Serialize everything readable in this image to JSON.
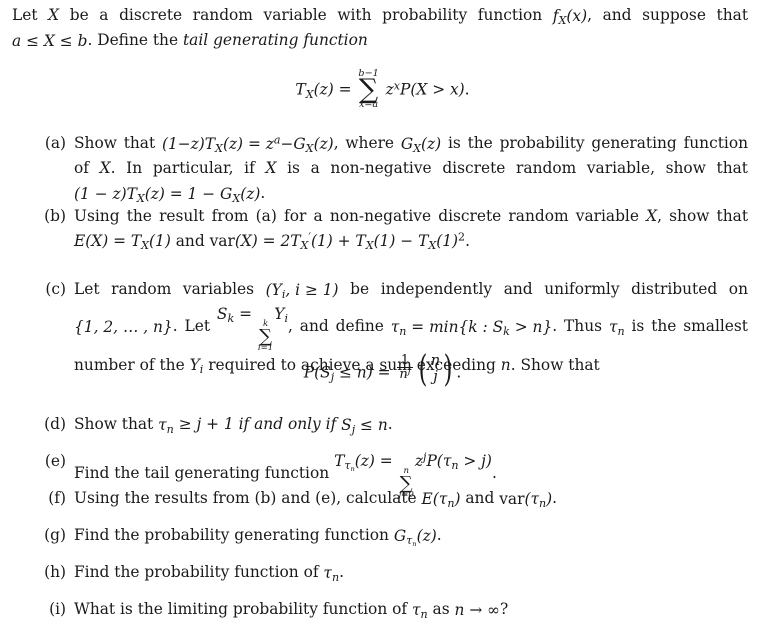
{
  "document": {
    "type": "mathematics-problem-set",
    "background_color": "#ffffff",
    "text_color": "#1a1a1a"
  },
  "intro": {
    "line1_a": "Let ",
    "var_X": "X",
    "line1_b": " be a discrete random variable with probability function ",
    "fx": {
      "base": "f",
      "sub": "X",
      "arg": "(x)"
    },
    "line1_c": ", and suppose that ",
    "cond_a": "a",
    "cond_le1": "≤",
    "cond_X": "X",
    "cond_le2": "≤",
    "cond_b": "b",
    "line2_a": ". Define the ",
    "emphasis": "tail generating function"
  },
  "main_equation": {
    "lhs_T": "T",
    "lhs_sub": "X",
    "lhs_arg": "(z)",
    "equals": "=",
    "sum_upper": "b−1",
    "sum_symbol": "∑",
    "sum_lower": "x=a",
    "term_z": "z",
    "term_exp": "x",
    "term_P": "P",
    "term_body": "(X > x)",
    "period": "."
  },
  "items": [
    {
      "label": "(a)",
      "text_parts": {
        "p1": "Show that ",
        "eq1": "(1−z)T",
        "eq1_sub": "X",
        "eq1_rest": "(z) = z",
        "eq1_exp": "a",
        "eq1_tail": "−G",
        "eq1_sub2": "X",
        "eq1_tail2": "(z)",
        "p2": ", where ",
        "eq2": "G",
        "eq2_sub": "X",
        "eq2_rest": "(z)",
        "p3": " is the probability generating function of ",
        "var2": "X",
        "p4": ". In particular, if ",
        "var3": "X",
        "p5": " is a non-negative discrete random variable, show that ",
        "eq3": "(1 − z)T",
        "eq3_sub": "X",
        "eq3_rest": "(z) = 1 − G",
        "eq3_sub2": "X",
        "eq3_tail": "(z)",
        "p6": "."
      }
    },
    {
      "label": "(b)",
      "text_parts": {
        "p1": "Using the result from (a) for a non-negative discrete random variable ",
        "var1": "X",
        "p2": ", show that ",
        "eq_E": "E(X) = T",
        "eq_E_sub": "X",
        "eq_E_rest": "(1)",
        "p3": " and ",
        "var_label": "var",
        "eq_v1": "(X) = 2T",
        "eq_v1_sub": "X",
        "eq_v1_prime": "′",
        "eq_v1_rest": "(1) + T",
        "eq_v2_sub": "X",
        "eq_v2_rest": "(1) − T",
        "eq_v3_sub": "X",
        "eq_v3_rest": "(1)",
        "eq_v3_exp": "2",
        "p4": "."
      }
    },
    {
      "label": "(c)",
      "text_parts": {
        "p1": "Let random variables ",
        "rv": "(Y",
        "rv_sub": "i",
        "rv_rest": ", i ≥ 1)",
        "p2": " be independently and uniformly distributed on ",
        "set": "{1, 2, … , n}",
        "p3": ". Let ",
        "S": "S",
        "S_sub": "k",
        "S_eq": " = ",
        "sum_upper": "k",
        "sum_lower": "i=1",
        "sum_body": "Y",
        "sum_body_sub": "i",
        "p4": ", and define ",
        "tau": "τ",
        "tau_sub": "n",
        "tau_def": " = min{k : S",
        "tau_def_sub": "k",
        "tau_def_rest": " > n}",
        "p5": ". Thus ",
        "tau2": "τ",
        "tau2_sub": "n",
        "p6": " is the smallest number of the ",
        "Y2": "Y",
        "Y2_sub": "i",
        "p7": " required to achieve a sum exceeding ",
        "n2": "n",
        "p8": ". Show that"
      }
    },
    {
      "label": "(d)",
      "text_parts": {
        "p1": "Show that ",
        "tau": "τ",
        "tau_sub": "n",
        "p2": " ≥ j + 1 if and only if ",
        "S": "S",
        "S_sub": "j",
        "p3": " ≤ n",
        "p4": "."
      }
    },
    {
      "label": "(e)",
      "text_parts": {
        "p1": "Find the tail generating function ",
        "T": "T",
        "T_sub_tau": "τ",
        "T_sub_n": "n",
        "T_arg": "(z) = ",
        "sum_upper": "n",
        "sum_lower": "j=0",
        "term_z": "z",
        "term_exp": "j",
        "term_P": "P(τ",
        "term_P_sub": "n",
        "term_P_rest": " > j)",
        "p2": "."
      }
    },
    {
      "label": "(f)",
      "text_parts": {
        "p1": "Using the results from (b) and (e), calculate ",
        "E": "E(τ",
        "E_sub": "n",
        "E_rest": ")",
        "p2": " and ",
        "var_label": "var",
        "var_body": "(τ",
        "var_sub": "n",
        "var_rest": ")",
        "p3": "."
      }
    },
    {
      "label": "(g)",
      "text_parts": {
        "p1": "Find the probability generating function ",
        "G": "G",
        "G_sub_tau": "τ",
        "G_sub_n": "n",
        "G_arg": "(z)",
        "p2": "."
      }
    },
    {
      "label": "(h)",
      "text_parts": {
        "p1": "Find the probability function of ",
        "tau": "τ",
        "tau_sub": "n",
        "p2": "."
      }
    },
    {
      "label": "(i)",
      "text_parts": {
        "p1": "What is the limiting probability function of ",
        "tau": "τ",
        "tau_sub": "n",
        "p2": " as ",
        "n": "n",
        "arrow": " → ∞",
        "p3": "?"
      }
    }
  ],
  "equation_c": {
    "lhs": "P(S",
    "lhs_sub": "j",
    "lhs_rest": " ≤ n)",
    "equals": " = ",
    "frac_num": "1",
    "frac_den_base": "n",
    "frac_den_exp": "j",
    "binom_top": "n",
    "binom_bottom": "j",
    "period": "."
  }
}
